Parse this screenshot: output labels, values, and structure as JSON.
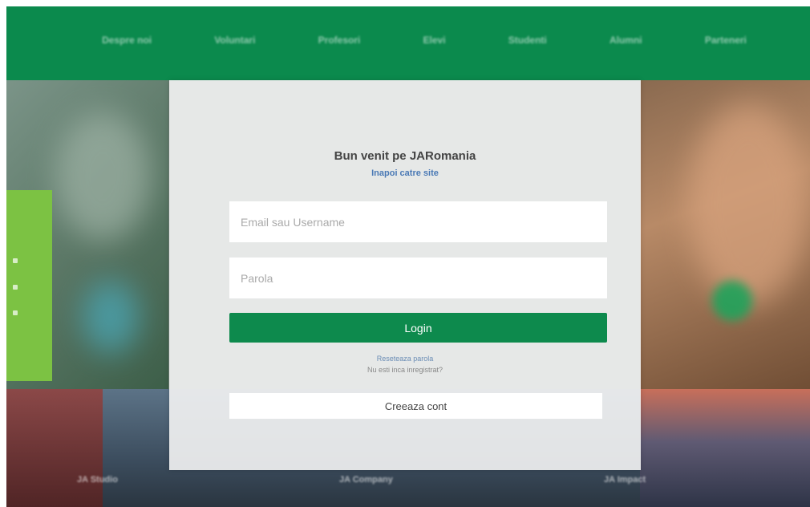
{
  "nav": {
    "items": [
      "Despre noi",
      "Voluntari",
      "Profesori",
      "Elevi",
      "Studenti",
      "Alumni",
      "Parteneri"
    ]
  },
  "login": {
    "welcome": "Bun venit pe JARomania",
    "back_link": "Inapoi catre site",
    "email_placeholder": "Email sau Username",
    "password_placeholder": "Parola",
    "login_label": "Login",
    "reset_label": "Reseteaza parola",
    "not_registered_label": "Nu esti inca inregistrat?",
    "create_label": "Creeaza cont"
  },
  "background": {
    "captions": [
      "JA Studio",
      "JA Company",
      "JA Impact"
    ]
  },
  "colors": {
    "brand_green": "#0b8a4d",
    "accent_lime": "#7cc243",
    "link_blue": "#4a79b5"
  }
}
